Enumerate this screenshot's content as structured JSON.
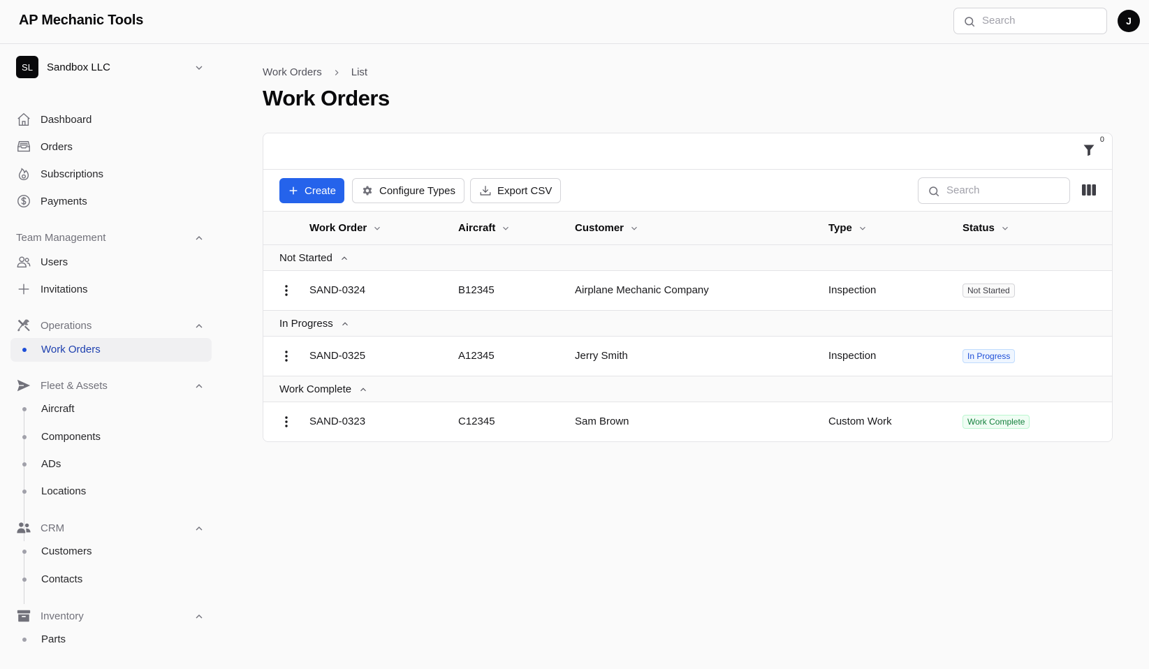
{
  "app": {
    "title": "AP Mechanic Tools",
    "search_placeholder": "Search",
    "avatar_initial": "J"
  },
  "org": {
    "initials": "SL",
    "name": "Sandbox LLC"
  },
  "sidebar": {
    "primary": [
      {
        "label": "Dashboard",
        "icon": "home-icon"
      },
      {
        "label": "Orders",
        "icon": "inbox-icon"
      },
      {
        "label": "Subscriptions",
        "icon": "fire-icon"
      },
      {
        "label": "Payments",
        "icon": "dollar-icon"
      }
    ],
    "team_management": {
      "label": "Team Management",
      "items": [
        {
          "label": "Users",
          "icon": "users-icon"
        },
        {
          "label": "Invitations",
          "icon": "plus-icon"
        }
      ]
    },
    "operations": {
      "label": "Operations",
      "icon": "wrench-icon",
      "items": [
        {
          "label": "Work Orders",
          "active": true
        }
      ]
    },
    "fleet": {
      "label": "Fleet & Assets",
      "icon": "paper-plane-icon",
      "items": [
        {
          "label": "Aircraft"
        },
        {
          "label": "Components"
        },
        {
          "label": "ADs"
        },
        {
          "label": "Locations"
        }
      ]
    },
    "crm": {
      "label": "CRM",
      "icon": "user-group-icon",
      "items": [
        {
          "label": "Customers"
        },
        {
          "label": "Contacts"
        }
      ]
    },
    "inventory": {
      "label": "Inventory",
      "icon": "archive-icon",
      "items": [
        {
          "label": "Parts"
        }
      ]
    }
  },
  "breadcrumb": {
    "first": "Work Orders",
    "second": "List"
  },
  "page": {
    "title": "Work Orders"
  },
  "filters": {
    "count": "0"
  },
  "toolbar": {
    "create_label": "Create",
    "configure_label": "Configure Types",
    "export_label": "Export CSV",
    "search_placeholder": "Search"
  },
  "table": {
    "columns": [
      "Work Order",
      "Aircraft",
      "Customer",
      "Type",
      "Status"
    ],
    "groups": [
      {
        "label": "Not Started",
        "rows": [
          {
            "work_order": "SAND-0324",
            "aircraft": "B12345",
            "customer": "Airplane Mechanic Company",
            "type": "Inspection",
            "status": "Not Started"
          }
        ]
      },
      {
        "label": "In Progress",
        "rows": [
          {
            "work_order": "SAND-0325",
            "aircraft": "A12345",
            "customer": "Jerry Smith",
            "type": "Inspection",
            "status": "In Progress"
          }
        ]
      },
      {
        "label": "Work Complete",
        "rows": [
          {
            "work_order": "SAND-0323",
            "aircraft": "C12345",
            "customer": "Sam Brown",
            "type": "Custom Work",
            "status": "Work Complete"
          }
        ]
      }
    ]
  },
  "colors": {
    "primary": "#2563eb",
    "active_text": "#1e40af",
    "status_not_started": "#3f3f46",
    "status_in_progress": "#1d4ed8",
    "status_complete": "#15803d"
  }
}
